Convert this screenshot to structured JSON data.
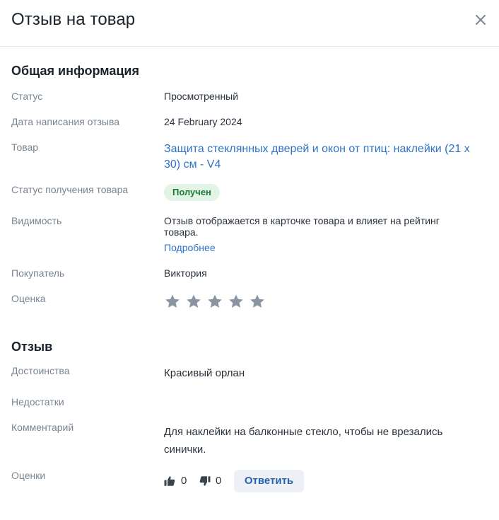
{
  "header": {
    "title": "Отзыв на товар"
  },
  "general": {
    "section_title": "Общая информация",
    "status_label": "Статус",
    "status_value": "Просмотренный",
    "date_label": "Дата написания отзыва",
    "date_value": "24 February 2024",
    "product_label": "Товар",
    "product_value": "Защита стеклянных дверей и окон от птиц: наклейки (21 x 30) см - V4",
    "receipt_label": "Статус получения товара",
    "receipt_value": "Получен",
    "visibility_label": "Видимость",
    "visibility_value": "Отзыв отображается в карточке товара и влияет на рейтинг товара.",
    "visibility_link": "Подробнее",
    "buyer_label": "Покупатель",
    "buyer_value": "Виктория",
    "rating_label": "Оценка",
    "rating_stars_filled": 0,
    "rating_stars_total": 5
  },
  "review": {
    "section_title": "Отзыв",
    "pros_label": "Достоинства",
    "pros_value": "Красивый орлан",
    "cons_label": "Недостатки",
    "cons_value": "",
    "comment_label": "Комментарий",
    "comment_value": "Для наклейки на балконные стекло, чтобы не врезались синички.",
    "votes_label": "Оценки",
    "likes": "0",
    "dislikes": "0",
    "reply_label": "Ответить"
  },
  "icons": {
    "close": "close-icon",
    "star": "star-icon",
    "like": "thumbs-up-icon",
    "dislike": "thumbs-down-icon"
  },
  "colors": {
    "accent": "#2e73c7",
    "badge_bg": "#e2f4e5",
    "badge_text": "#1d7a35",
    "star_empty": "#8a94a3",
    "muted_text": "#7a8591"
  }
}
